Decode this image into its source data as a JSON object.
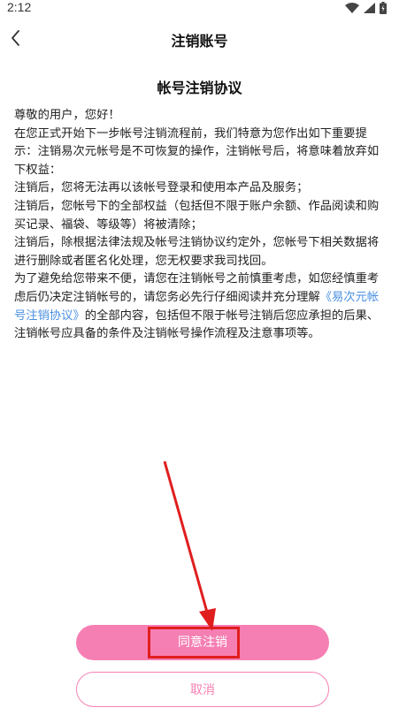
{
  "status_bar": {
    "time": "2:12"
  },
  "nav": {
    "title": "注销账号"
  },
  "document": {
    "title": "帐号注销协议",
    "paragraphs": [
      "尊敬的用户，您好！",
      "在您正式开始下一步帐号注销流程前，我们特意为您作出如下重要提示：注销易次元帐号是不可恢复的操作，注销帐号后，将意味着放弃如下权益：",
      "注销后，您将无法再以该帐号登录和使用本产品及服务；",
      "注销后，您帐号下的全部权益（包括但不限于账户余额、作品阅读和购买记录、福袋、等级等）将被清除；",
      "注销后，除根据法律法规及帐号注销协议约定外，您帐号下相关数据将进行删除或者匿名化处理，您无权要求我司找回。"
    ],
    "last_before": "为了避免给您带来不便，请您在注销帐号之前慎重考虑，如您经慎重考虑后仍决定注销帐号的，请您务必先行仔细阅读并充分理解",
    "agreement_link": "《易次元帐号注销协议》",
    "last_after": "的全部内容，包括但不限于帐号注销后您应承担的后果、注销帐号应具备的条件及注销帐号操作流程及注意事项等。"
  },
  "buttons": {
    "confirm": "同意注销",
    "cancel": "取消"
  },
  "colors": {
    "accent": "#f57fb3",
    "link": "#4a90e2",
    "annotation": "#e01e1e"
  }
}
